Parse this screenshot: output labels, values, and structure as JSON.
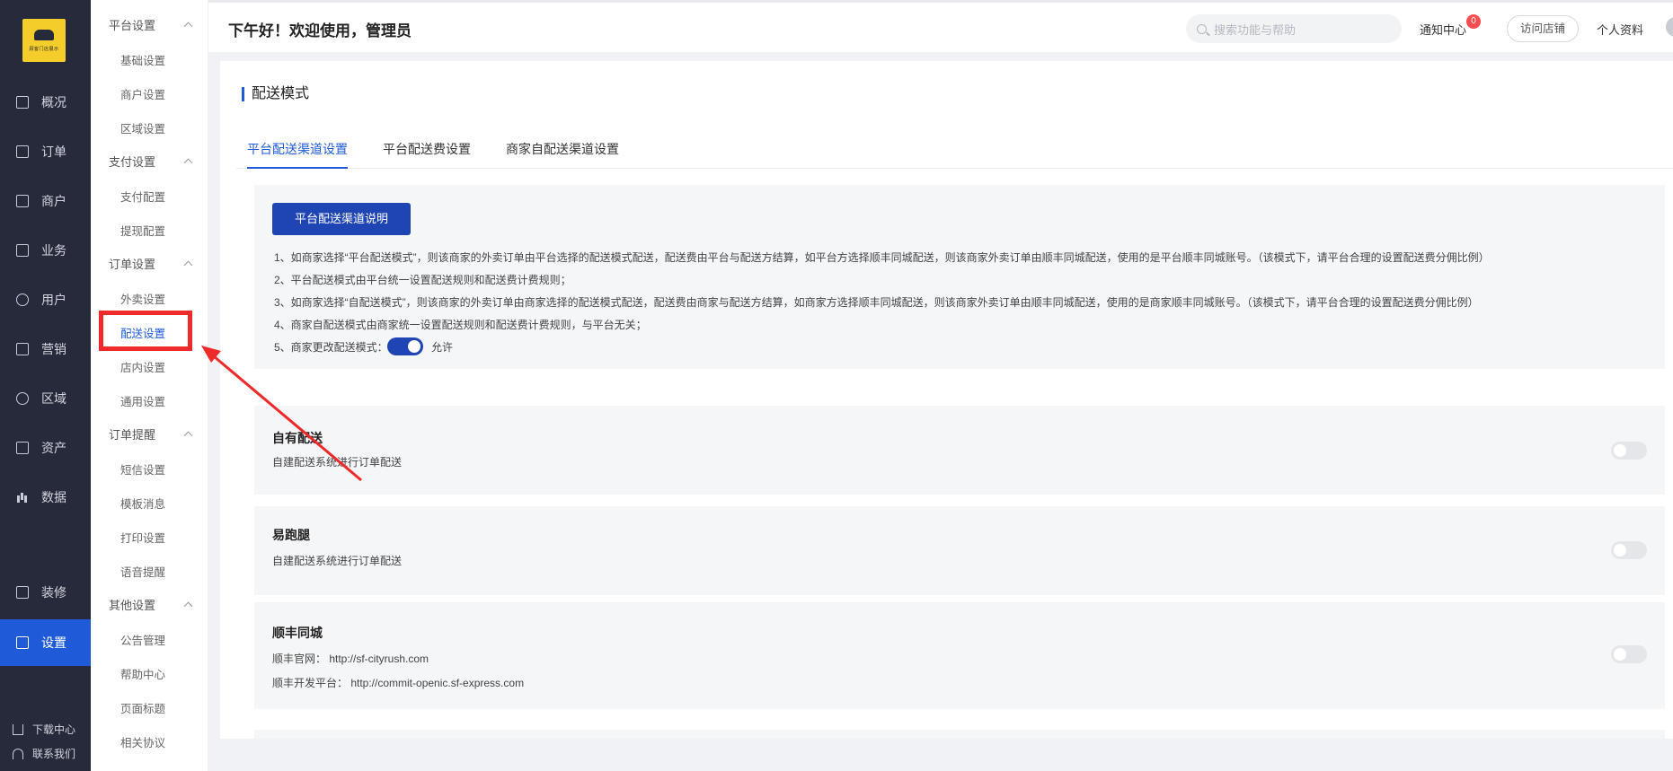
{
  "brand": {
    "logo_text": "顾客门店展示",
    "accent": "#1f5bd9",
    "highlight_color": "#ee2a2a"
  },
  "nav": {
    "items": [
      {
        "label": "概况",
        "icon": "presentation-icon"
      },
      {
        "label": "订单",
        "icon": "order-icon"
      },
      {
        "label": "商户",
        "icon": "merchant-icon"
      },
      {
        "label": "业务",
        "icon": "business-icon"
      },
      {
        "label": "用户",
        "icon": "user-icon"
      },
      {
        "label": "营销",
        "icon": "marketing-icon"
      },
      {
        "label": "区域",
        "icon": "region-icon"
      },
      {
        "label": "资产",
        "icon": "asset-icon"
      },
      {
        "label": "数据",
        "icon": "chart-icon"
      },
      {
        "label": "装修",
        "icon": "decorate-icon"
      },
      {
        "label": "设置",
        "icon": "settings-icon"
      }
    ],
    "footer": {
      "download": "下载中心",
      "contact": "联系我们"
    }
  },
  "subnav": {
    "groups": [
      {
        "title": "平台设置",
        "items": [
          "基础设置",
          "商户设置",
          "区域设置"
        ]
      },
      {
        "title": "支付设置",
        "items": [
          "支付配置",
          "提现配置"
        ]
      },
      {
        "title": "订单设置",
        "items": [
          "外卖设置",
          "配送设置",
          "店内设置",
          "通用设置"
        ]
      },
      {
        "title": "订单提醒",
        "items": [
          "短信设置",
          "模板消息",
          "打印设置",
          "语音提醒"
        ]
      },
      {
        "title": "其他设置",
        "items": [
          "公告管理",
          "帮助中心",
          "页面标题",
          "相关协议"
        ]
      }
    ]
  },
  "header": {
    "greeting": "下午好！欢迎使用，管理员",
    "search_placeholder": "搜索功能与帮助",
    "notice": "通知中心",
    "notice_count": "0",
    "visit_store": "访问店铺",
    "profile": "个人资料"
  },
  "main": {
    "title": "配送模式",
    "tabs": [
      "平台配送渠道设置",
      "平台配送费设置",
      "商家自配送渠道设置"
    ],
    "info": {
      "button": "平台配送渠道说明",
      "lines": [
        "1、如商家选择“平台配送模式”，则该商家的外卖订单由平台选择的配送模式配送，配送费由平台与配送方结算，如平台方选择顺丰同城配送，则该商家外卖订单由顺丰同城配送，使用的是平台顺丰同城账号。（该模式下，请平台合理的设置配送费分佣比例）",
        "2、平台配送模式由平台统一设置配送规则和配送费计费规则；",
        "3、如商家选择“自配送模式”，则该商家的外卖订单由商家选择的配送模式配送，配送费由商家与配送方结算，如商家方选择顺丰同城配送，则该商家外卖订单由顺丰同城配送，使用的是商家顺丰同城账号。（该模式下，请平台合理的设置配送费分佣比例）",
        "4、商家自配送模式由商家统一设置配送规则和配送费计费规则，与平台无关；"
      ],
      "line5": "5、商家更改配送模式：",
      "allow": "允许"
    },
    "channels": [
      {
        "name": "自有配送",
        "desc": [
          "自建配送系统进行订单配送"
        ]
      },
      {
        "name": "易跑腿",
        "desc": [
          "自建配送系统进行订单配送"
        ]
      },
      {
        "name": "顺丰同城",
        "desc": [
          "顺丰官网： http://sf-cityrush.com",
          "顺丰开发平台： http://commit-openic.sf-express.com"
        ]
      }
    ]
  }
}
